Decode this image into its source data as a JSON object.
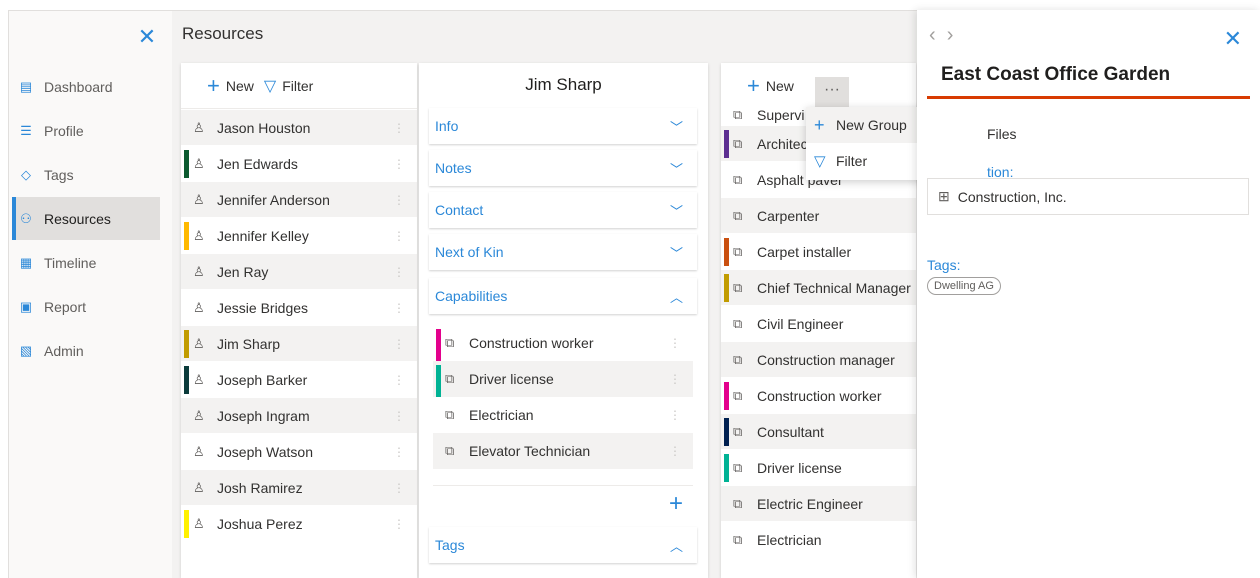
{
  "sidebar": {
    "items": [
      {
        "label": "Dashboard",
        "icon": "dashboard-icon"
      },
      {
        "label": "Profile",
        "icon": "profile-icon"
      },
      {
        "label": "Tags",
        "icon": "tag-icon"
      },
      {
        "label": "Resources",
        "icon": "resources-icon"
      },
      {
        "label": "Timeline",
        "icon": "timeline-icon"
      },
      {
        "label": "Report",
        "icon": "report-icon"
      },
      {
        "label": "Admin",
        "icon": "admin-icon"
      }
    ],
    "active": "Resources"
  },
  "page_title": "Resources",
  "people_panel": {
    "new_label": "New",
    "filter_label": "Filter",
    "rows": [
      {
        "name": "Jason Houston",
        "color": ""
      },
      {
        "name": "Jen Edwards",
        "color": "#0b5a2f"
      },
      {
        "name": "Jennifer Anderson",
        "color": ""
      },
      {
        "name": "Jennifer Kelley",
        "color": "#ffb900"
      },
      {
        "name": "Jen Ray",
        "color": ""
      },
      {
        "name": "Jessie Bridges",
        "color": ""
      },
      {
        "name": "Jim Sharp",
        "color": "#c19c00"
      },
      {
        "name": "Joseph Barker",
        "color": "#0b3b3b"
      },
      {
        "name": "Joseph Ingram",
        "color": ""
      },
      {
        "name": "Joseph Watson",
        "color": ""
      },
      {
        "name": "Josh Ramirez",
        "color": ""
      },
      {
        "name": "Joshua Perez",
        "color": "#fff100"
      }
    ]
  },
  "detail_panel": {
    "name": "Jim Sharp",
    "sections": [
      "Info",
      "Notes",
      "Contact",
      "Next of Kin",
      "Capabilities",
      "Tags"
    ],
    "capabilities": [
      {
        "label": "Construction worker",
        "color": "#e3008c"
      },
      {
        "label": "Driver license",
        "color": "#00b294"
      },
      {
        "label": "Electrician",
        "color": ""
      },
      {
        "label": "Elevator Technician",
        "color": ""
      }
    ]
  },
  "groups_panel": {
    "new_label": "New",
    "more_label": "···",
    "rows": [
      {
        "label": "Supervi",
        "color": ""
      },
      {
        "label": "Architec",
        "color": "#5c2e91"
      },
      {
        "label": "Asphalt paver",
        "color": ""
      },
      {
        "label": "Carpenter",
        "color": ""
      },
      {
        "label": "Carpet installer",
        "color": "#ca5010"
      },
      {
        "label": "Chief Technical Manager",
        "color": "#c19c00"
      },
      {
        "label": "Civil Engineer",
        "color": ""
      },
      {
        "label": "Construction manager",
        "color": ""
      },
      {
        "label": "Construction worker",
        "color": "#e3008c"
      },
      {
        "label": "Consultant",
        "color": "#002050"
      },
      {
        "label": "Driver license",
        "color": "#00b294"
      },
      {
        "label": "Electric Engineer",
        "color": ""
      },
      {
        "label": "Electrician",
        "color": ""
      }
    ]
  },
  "context_menu": {
    "items": [
      "New Group",
      "Filter"
    ]
  },
  "right_panel": {
    "title": "East Coast Office Garden",
    "files_label": "Files",
    "org_label": "tion:",
    "org_value": "Construction, Inc.",
    "tags_label": "Tags:",
    "tag": "Dwelling AG"
  },
  "colors": {
    "accent": "#2b88d8",
    "title_underline": "#d83b01"
  }
}
